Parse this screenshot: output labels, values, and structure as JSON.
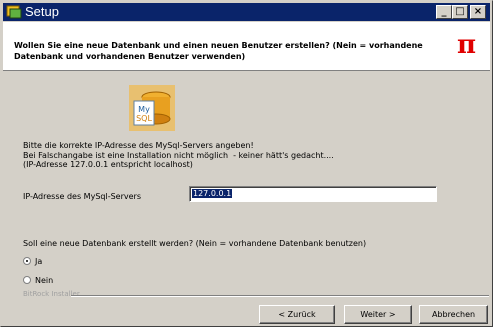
{
  "window": {
    "title": "Setup"
  },
  "titlebar": {
    "minimize": "_",
    "maximize": "□",
    "close": "×"
  },
  "header": {
    "text": "Wollen Sie eine neue Datenbank und einen neuen Benutzer erstellen? (Nein = vorhandene Datenbank und vorhandenen Benutzer verwenden)",
    "pi_symbol": "π"
  },
  "logo": {
    "line1": "My",
    "line2": "SQL"
  },
  "info": {
    "line1": "Bitte die korrekte IP-Adresse des MySql-Servers angeben!",
    "line2": "Bei Falschangabe ist eine Installation nicht möglich  - keiner hätt's gedacht....",
    "line3": "(IP-Adresse 127.0.0.1 entspricht localhost)"
  },
  "ip_field": {
    "label": "IP-Adresse des MySql-Servers",
    "value": "127.0.0.1"
  },
  "question": {
    "text": "Soll eine neue Datenbank erstellt werden? (Nein = vorhandene Datenbank benutzen)"
  },
  "options": [
    {
      "label": "Ja",
      "checked": true
    },
    {
      "label": "Nein",
      "checked": false
    }
  ],
  "footer": {
    "installer_label": "BitRock Installer"
  },
  "buttons": {
    "back": "< Zurück",
    "next": "Weiter >",
    "cancel": "Abbrechen"
  }
}
